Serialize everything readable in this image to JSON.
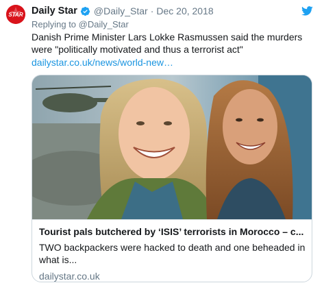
{
  "tweet": {
    "author_name": "Daily Star",
    "avatar_text": "STAR",
    "handle": "@Daily_Star",
    "separator": "·",
    "date": "Dec 20, 2018",
    "reply_prefix": "Replying to",
    "reply_handle": "@Daily_Star",
    "text": "Danish Prime Minister Lars Lokke Rasmussen said the murders were \"politically motivated and thus a terrorist act\"",
    "link": "dailystar.co.uk/news/world-new…"
  },
  "card": {
    "title": "Tourist pals butchered by ‘ISIS’ terrorists in Morocco – c...",
    "description": "TWO backpackers were hacked to death and one beheaded in what is...",
    "domain": "dailystar.co.uk"
  },
  "colors": {
    "brand_red": "#d9131b",
    "twitter_blue": "#1da1f2",
    "link_blue": "#1b95e0",
    "secondary_text": "#657786"
  },
  "icons": {
    "verified": "verified-badge-icon",
    "twitter": "twitter-bird-icon"
  }
}
